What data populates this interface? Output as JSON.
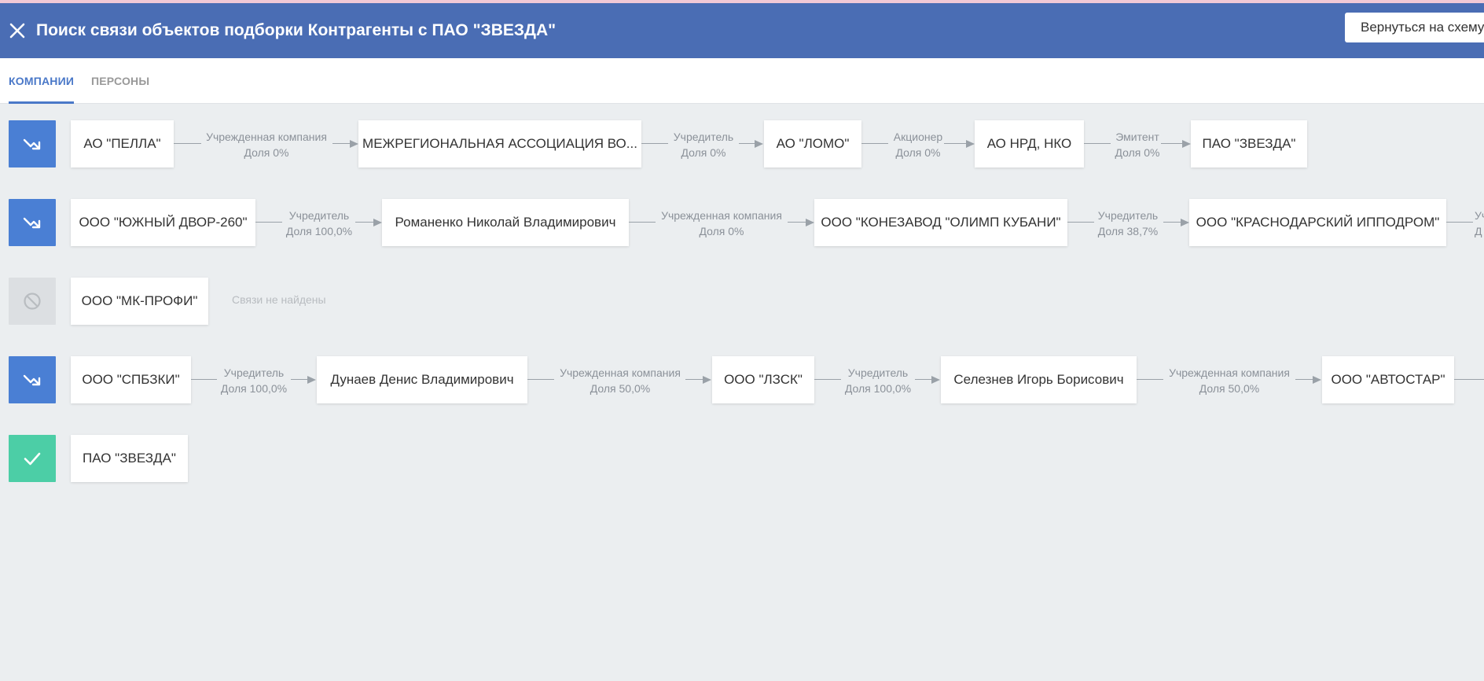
{
  "header": {
    "title": "Поиск связи объектов подборки Контрагенты с ПАО \"ЗВЕЗДА\"",
    "back_button": "Вернуться на схему",
    "close_icon": "close-icon",
    "background": "#4a6db4"
  },
  "tabs": [
    {
      "label": "КОМПАНИИ",
      "active": true
    },
    {
      "label": "ПЕРСОНЫ",
      "active": false
    }
  ],
  "rows": [
    {
      "status": "path-found",
      "status_icon": "trending-up-icon",
      "nodes": [
        "АО \"ПЕЛЛА\"",
        "МЕЖРЕГИОНАЛЬНАЯ АССОЦИАЦИЯ ВО...",
        "АО \"ЛОМО\"",
        "АО НРД, НКО",
        "ПАО \"ЗВЕЗДА\""
      ],
      "links": [
        {
          "type": "Учрежденная компания",
          "share": "Доля 0%"
        },
        {
          "type": "Учредитель",
          "share": "Доля 0%"
        },
        {
          "type": "Акционер",
          "share": "Доля 0%"
        },
        {
          "type": "Эмитент",
          "share": "Доля 0%"
        }
      ]
    },
    {
      "status": "path-found",
      "status_icon": "trending-up-icon",
      "nodes": [
        "ООО \"ЮЖНЫЙ ДВОР-260\"",
        "Романенко Николай Владимирович",
        "ООО \"КОНЕЗАВОД \"ОЛИМП КУБАНИ\"",
        "ООО \"КРАСНОДАРСКИЙ ИППОДРОМ\""
      ],
      "links": [
        {
          "type": "Учредитель",
          "share": "Доля 100,0%"
        },
        {
          "type": "Учрежденная компания",
          "share": "Доля 0%"
        },
        {
          "type": "Учредитель",
          "share": "Доля 38,7%"
        }
      ],
      "trailing_label": {
        "type": "Уч",
        "share": "Д"
      }
    },
    {
      "status": "not-found",
      "status_icon": "block-icon",
      "nodes": [
        "ООО \"МК-ПРОФИ\""
      ],
      "links": [],
      "message": "Связи не найдены"
    },
    {
      "status": "path-found",
      "status_icon": "trending-up-icon",
      "nodes": [
        "ООО \"СПБЗКИ\"",
        "Дунаев Денис Владимирович",
        "ООО \"ЛЗСК\"",
        "Селезнев Игорь Борисович",
        "ООО \"АВТОСТАР\""
      ],
      "links": [
        {
          "type": "Учредитель",
          "share": "Доля 100,0%"
        },
        {
          "type": "Учрежденная компания",
          "share": "Доля 50,0%"
        },
        {
          "type": "Учредитель",
          "share": "Доля 100,0%"
        },
        {
          "type": "Учрежденная компания",
          "share": "Доля 50,0%"
        }
      ]
    },
    {
      "status": "target",
      "status_icon": "check-icon",
      "nodes": [
        "ПАО \"ЗВЕЗДА\""
      ],
      "links": []
    }
  ],
  "colors": {
    "accent": "#4a78c8",
    "status_blue": "#4a7fd4",
    "status_gray": "#dcdfe2",
    "status_green": "#4ccea6",
    "background": "#ebeef0"
  }
}
